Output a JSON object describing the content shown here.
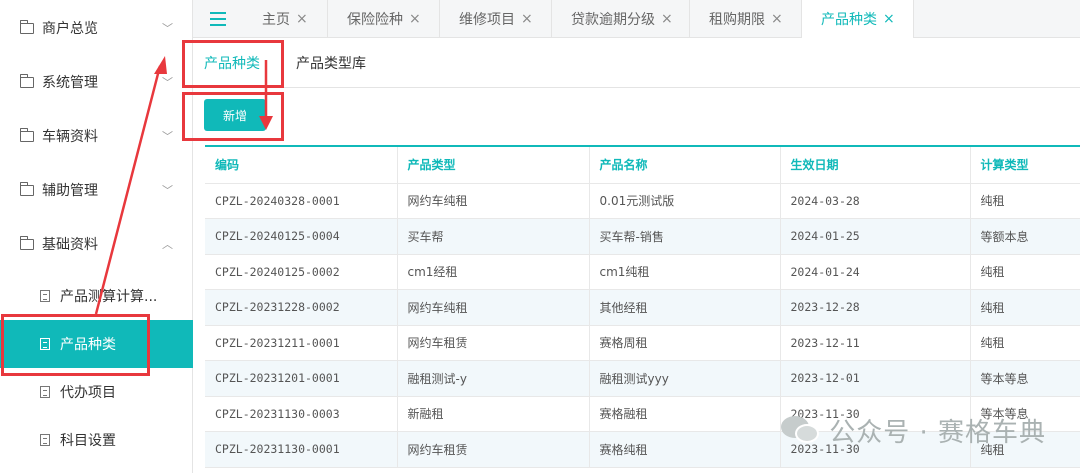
{
  "sidebar": {
    "menu": [
      {
        "label": "商户总览",
        "chevron": "down"
      },
      {
        "label": "系统管理",
        "chevron": "down"
      },
      {
        "label": "车辆资料",
        "chevron": "down"
      },
      {
        "label": "辅助管理",
        "chevron": "down"
      },
      {
        "label": "基础资料",
        "chevron": "up"
      }
    ],
    "sub_items": [
      {
        "label": "产品测算计算...",
        "active": false
      },
      {
        "label": "产品种类",
        "active": true
      },
      {
        "label": "代办项目",
        "active": false
      },
      {
        "label": "科目设置",
        "active": false
      }
    ]
  },
  "tabs": [
    {
      "label": "主页",
      "close": "×",
      "active": false
    },
    {
      "label": "保险险种",
      "close": "×",
      "active": false
    },
    {
      "label": "维修项目",
      "close": "×",
      "active": false
    },
    {
      "label": "贷款逾期分级",
      "close": "×",
      "active": false
    },
    {
      "label": "租购期限",
      "close": "×",
      "active": false
    },
    {
      "label": "产品种类",
      "close": "×",
      "active": true
    }
  ],
  "subtabs": [
    {
      "label": "产品种类",
      "active": true
    },
    {
      "label": "产品类型库",
      "active": false
    }
  ],
  "toolbar": {
    "add_label": "新增"
  },
  "table": {
    "columns": [
      "编码",
      "产品类型",
      "产品名称",
      "生效日期",
      "计算类型"
    ],
    "rows": [
      [
        "CPZL-20240328-0001",
        "网约车纯租",
        "0.01元测试版",
        "2024-03-28",
        "纯租"
      ],
      [
        "CPZL-20240125-0004",
        "买车帮",
        "买车帮-销售",
        "2024-01-25",
        "等额本息"
      ],
      [
        "CPZL-20240125-0002",
        "cm1经租",
        "cm1纯租",
        "2024-01-24",
        "纯租"
      ],
      [
        "CPZL-20231228-0002",
        "网约车纯租",
        "其他经租",
        "2023-12-28",
        "纯租"
      ],
      [
        "CPZL-20231211-0001",
        "网约车租赁",
        "赛格周租",
        "2023-12-11",
        "纯租"
      ],
      [
        "CPZL-20231201-0001",
        "融租测试-y",
        "融租测试yyy",
        "2023-12-01",
        "等本等息"
      ],
      [
        "CPZL-20231130-0003",
        "新融租",
        "赛格融租",
        "2023-11-30",
        "等本等息"
      ],
      [
        "CPZL-20231130-0001",
        "网约车租赁",
        "赛格纯租",
        "2023-11-30",
        "纯租"
      ]
    ]
  },
  "watermark": {
    "text": "公众号 · 赛格车典"
  },
  "colors": {
    "accent": "#10b9b9",
    "annotation": "#e8383d"
  }
}
